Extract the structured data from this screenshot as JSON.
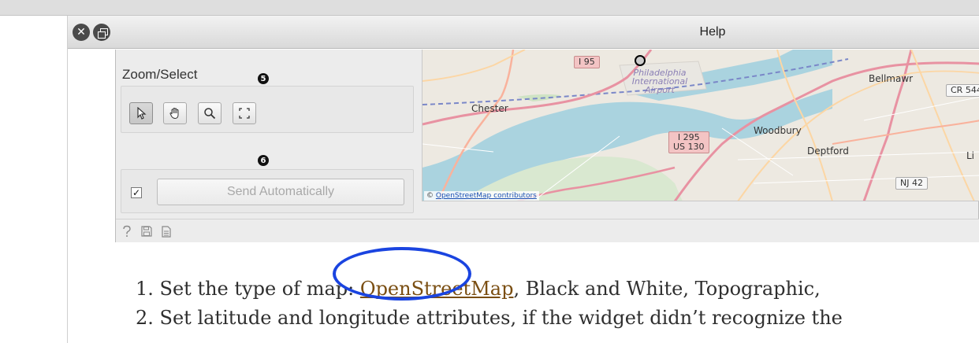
{
  "window": {
    "title": "Help",
    "close_glyph": "✕"
  },
  "widget": {
    "zoom_select_title": "Zoom/Select",
    "badge_5": "❺",
    "badge_6": "❻",
    "tools": [
      {
        "icon": "pointer-icon",
        "active": true
      },
      {
        "icon": "hand-icon",
        "active": false
      },
      {
        "icon": "magnifier-icon",
        "active": false
      },
      {
        "icon": "fit-screen-icon",
        "active": false
      }
    ],
    "send_checkbox_checked": true,
    "send_checkbox_mark": "✓",
    "send_label": "Send Automatically",
    "status_icons": [
      "help-icon",
      "save-icon",
      "report-icon"
    ]
  },
  "map": {
    "places": {
      "chester": "Chester",
      "bellmawr": "Bellmawr",
      "woodbury": "Woodbury",
      "deptford": "Deptford",
      "airport": "Philadelphia International Airport",
      "li": "Li"
    },
    "shields": {
      "i95": "I 95",
      "i295": "I 295",
      "us130": "US 130",
      "cr544": "CR 544",
      "nj42": "NJ 42"
    },
    "attribution_prefix": "© ",
    "attribution_link": "OpenStreetMap contributors",
    "colors": {
      "water": "#aad3df",
      "land": "#ede9e1",
      "motorway": "#e892a2",
      "trunk": "#f9b29c",
      "primary": "#fcd6a4"
    }
  },
  "steps": {
    "step1_prefix": "1. Set the type of map: ",
    "step1_link": "OpenStreetMap",
    "step1_suffix": ", Black and White, Topographic,",
    "step2": "2. Set latitude and longitude attributes, if the widget didn’t recognize the"
  },
  "highlight": {
    "color": "#1a44e0"
  }
}
